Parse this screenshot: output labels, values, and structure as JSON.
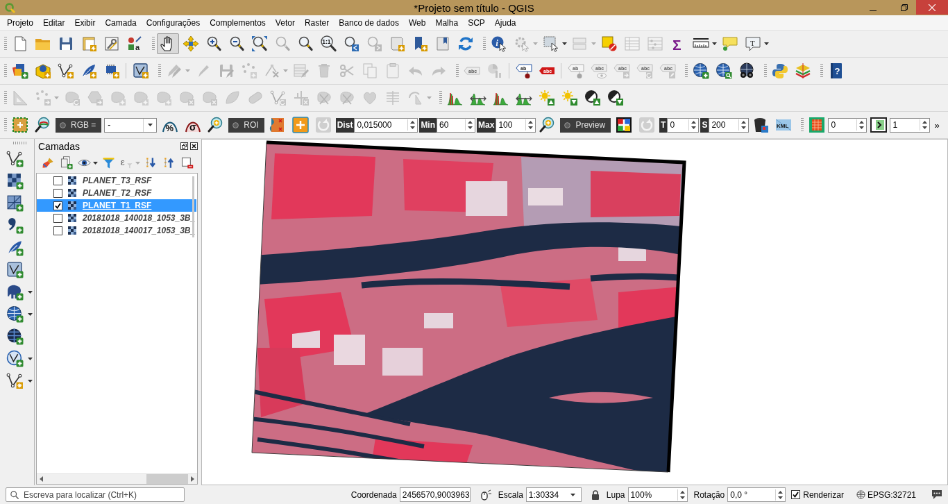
{
  "window": {
    "title": "*Projeto sem título - QGIS"
  },
  "menu": [
    "Projeto",
    "Editar",
    "Exibir",
    "Camada",
    "Configurações",
    "Complementos",
    "Vetor",
    "Raster",
    "Banco de dados",
    "Web",
    "Malha",
    "SCP",
    "Ajuda"
  ],
  "toolbars": [
    {
      "groups": [
        {
          "tools": [
            {
              "kind": "page",
              "disabled": false
            },
            {
              "kind": "folder",
              "disabled": false
            },
            {
              "kind": "floppy",
              "disabled": false
            },
            {
              "kind": "layout",
              "disabled": false
            },
            {
              "kind": "wrench",
              "disabled": false
            },
            {
              "kind": "style",
              "disabled": false,
              "glyph": "a"
            }
          ]
        },
        {
          "tools": [
            {
              "kind": "hand",
              "disabled": false,
              "pressed": true
            },
            {
              "kind": "movearrows",
              "disabled": false,
              "pressed": false
            },
            {
              "kind": "zoomin",
              "disabled": false,
              "pressed": false
            },
            {
              "kind": "zoomout",
              "disabled": false,
              "pressed": false
            },
            {
              "kind": "zoomfull",
              "disabled": false,
              "pressed": false
            },
            {
              "kind": "zoomplain",
              "disabled": true,
              "pressed": false
            },
            {
              "kind": "zoomplain",
              "disabled": false,
              "pressed": false
            },
            {
              "kind": "zoomnative",
              "disabled": false,
              "pressed": false,
              "glyph": "1:1"
            },
            {
              "kind": "zoomlast",
              "disabled": false,
              "pressed": false
            },
            {
              "kind": "zoomnext",
              "disabled": true,
              "pressed": false
            },
            {
              "kind": "mapsheet",
              "disabled": false,
              "pressed": false
            },
            {
              "kind": "bookmarkadd",
              "disabled": false,
              "pressed": false
            },
            {
              "kind": "bookmarks",
              "disabled": false,
              "pressed": false
            },
            {
              "kind": "refresh",
              "disabled": false,
              "pressed": false
            }
          ]
        },
        {
          "tools": [
            {
              "kind": "identify",
              "disabled": false,
              "glyph": "i"
            },
            {
              "kind": "action",
              "disabled": true
            },
            {
              "kind": "caret",
              "disabled": true
            },
            {
              "kind": "select",
              "disabled": false
            },
            {
              "kind": "caret",
              "disabled": false
            },
            {
              "kind": "selform",
              "disabled": true
            },
            {
              "kind": "caret",
              "disabled": true
            },
            {
              "kind": "deselect",
              "disabled": false
            },
            {
              "kind": "table",
              "disabled": true
            },
            {
              "kind": "abacus",
              "disabled": true
            },
            {
              "kind": "sigma",
              "disabled": false,
              "glyph": "Σ"
            },
            {
              "kind": "ruler",
              "disabled": false
            },
            {
              "kind": "caret",
              "disabled": false
            },
            {
              "kind": "balloon",
              "disabled": false
            },
            {
              "kind": "textnote",
              "disabled": false,
              "glyph": "T"
            },
            {
              "kind": "caret",
              "disabled": false
            }
          ]
        }
      ]
    },
    {
      "groups": [
        {
          "tools": [
            {
              "kind": "datasource",
              "disabled": false
            },
            {
              "kind": "geopackage",
              "disabled": false
            },
            {
              "kind": "shapefile",
              "disabled": false
            },
            {
              "kind": "spatialite",
              "disabled": false
            },
            {
              "kind": "scratch",
              "disabled": false
            },
            {
              "kind": "sep"
            },
            {
              "kind": "virtual",
              "disabled": false
            }
          ]
        },
        {
          "tools": [
            {
              "kind": "pencils",
              "disabled": true
            },
            {
              "kind": "caret",
              "disabled": true
            },
            {
              "kind": "pencil",
              "disabled": true
            },
            {
              "kind": "floppyedit",
              "disabled": true
            },
            {
              "kind": "addpoints",
              "disabled": true
            },
            {
              "kind": "vertex",
              "disabled": true
            },
            {
              "kind": "caret",
              "disabled": true
            },
            {
              "kind": "attredit",
              "disabled": true
            },
            {
              "kind": "trash",
              "disabled": true
            },
            {
              "kind": "scissors",
              "disabled": true
            },
            {
              "kind": "copy",
              "disabled": true
            },
            {
              "kind": "paste",
              "disabled": true
            },
            {
              "kind": "undo",
              "disabled": true
            },
            {
              "kind": "redo",
              "disabled": true
            }
          ]
        },
        {
          "tools": [
            {
              "kind": "tag",
              "disabled": true,
              "glyph": "abc"
            },
            {
              "kind": "diagram",
              "disabled": true
            },
            {
              "kind": "sep"
            },
            {
              "kind": "tagpin",
              "disabled": false,
              "glyph": "ab"
            },
            {
              "kind": "tagred",
              "disabled": false,
              "glyph": "abc"
            },
            {
              "kind": "sep"
            },
            {
              "kind": "tagpin",
              "disabled": true,
              "glyph": "ab"
            },
            {
              "kind": "tageye",
              "disabled": true,
              "glyph": "abc"
            },
            {
              "kind": "tagmove",
              "disabled": true,
              "glyph": "abc"
            },
            {
              "kind": "tagrot",
              "disabled": true,
              "glyph": "abc"
            },
            {
              "kind": "tagedit",
              "disabled": true,
              "glyph": "abc"
            }
          ]
        },
        {
          "tools": [
            {
              "kind": "globeadd",
              "disabled": false
            },
            {
              "kind": "globesearch",
              "disabled": false
            },
            {
              "kind": "globebinoc",
              "disabled": false
            }
          ]
        },
        {
          "tools": [
            {
              "kind": "python",
              "disabled": false
            },
            {
              "kind": "scp",
              "disabled": false
            }
          ]
        },
        {
          "tools": [
            {
              "kind": "help",
              "disabled": false,
              "glyph": "?"
            }
          ]
        }
      ]
    },
    {
      "groups": [
        {
          "tools": [
            {
              "kind": "setsquare",
              "disabled": true
            },
            {
              "kind": "pointsmove",
              "disabled": true
            },
            {
              "kind": "caret",
              "disabled": true
            },
            {
              "kind": "blobrot",
              "disabled": true
            },
            {
              "kind": "hexmove",
              "disabled": true
            },
            {
              "kind": "blobstar",
              "disabled": true
            },
            {
              "kind": "blobstar",
              "disabled": true
            },
            {
              "kind": "blobstar",
              "disabled": true
            },
            {
              "kind": "blobx",
              "disabled": true
            },
            {
              "kind": "blobx",
              "disabled": true
            },
            {
              "kind": "leaf",
              "disabled": true
            },
            {
              "kind": "capsule",
              "disabled": true
            },
            {
              "kind": "vrot",
              "disabled": true
            },
            {
              "kind": "splitx",
              "disabled": true
            },
            {
              "kind": "blobcut",
              "disabled": true
            },
            {
              "kind": "blobcut",
              "disabled": true
            },
            {
              "kind": "merge",
              "disabled": true
            },
            {
              "kind": "align",
              "disabled": true
            },
            {
              "kind": "rotpointer",
              "disabled": true
            },
            {
              "kind": "caret",
              "disabled": true
            }
          ]
        },
        {
          "tools": [
            {
              "kind": "histo",
              "disabled": false
            },
            {
              "kind": "histoarrows",
              "disabled": false
            },
            {
              "kind": "histo",
              "disabled": false
            },
            {
              "kind": "histoarrows",
              "disabled": false
            },
            {
              "kind": "sunup",
              "disabled": false
            },
            {
              "kind": "sundown",
              "disabled": false
            },
            {
              "kind": "contrastup",
              "disabled": false
            },
            {
              "kind": "contrastdown",
              "disabled": false
            }
          ]
        }
      ]
    },
    {
      "groups": [
        {
          "tools": [
            {
              "kind": "scproi",
              "disabled": false
            },
            {
              "kind": "magband",
              "disabled": false
            },
            {
              "kind": "chip",
              "label": "RGB =",
              "checked": false
            },
            {
              "kind": "combo",
              "value": "-"
            },
            {
              "kind": "pct",
              "disabled": false,
              "glyph": "%"
            },
            {
              "kind": "sig",
              "disabled": false,
              "glyph": "σ"
            },
            {
              "kind": "zoomplus",
              "disabled": false
            },
            {
              "kind": "chip",
              "label": "ROI",
              "checked": false
            },
            {
              "kind": "roix",
              "disabled": false
            },
            {
              "kind": "orangeplus",
              "disabled": false
            },
            {
              "kind": "refreshgrey",
              "disabled": true
            },
            {
              "kind": "param",
              "label": "Dist"
            },
            {
              "kind": "spin",
              "value": "0,015000"
            },
            {
              "kind": "param",
              "label": "Min"
            },
            {
              "kind": "spin",
              "value": "60"
            },
            {
              "kind": "param",
              "label": "Max"
            },
            {
              "kind": "spin",
              "value": "100"
            },
            {
              "kind": "zoomplus",
              "disabled": false
            },
            {
              "kind": "chip",
              "label": "Preview",
              "checked": false
            },
            {
              "kind": "colorful",
              "disabled": false
            },
            {
              "kind": "refreshgrey",
              "disabled": true
            },
            {
              "kind": "param",
              "label": "T"
            },
            {
              "kind": "spin",
              "value": "0"
            },
            {
              "kind": "param",
              "label": "S"
            },
            {
              "kind": "spin",
              "value": "200"
            },
            {
              "kind": "bin",
              "disabled": false
            },
            {
              "kind": "kml",
              "disabled": false,
              "glyph": "KML"
            }
          ]
        },
        {
          "tools": [
            {
              "kind": "gridicon",
              "disabled": false
            },
            {
              "kind": "spin",
              "value": "0"
            },
            {
              "kind": "arrowbox",
              "disabled": false
            },
            {
              "kind": "spin",
              "value": "1"
            },
            {
              "kind": "more",
              "label": "»"
            }
          ]
        }
      ]
    }
  ],
  "side_toolbar": {
    "tools": [
      {
        "kind": "vadd",
        "disabled": false
      },
      {
        "kind": "rasteradd",
        "disabled": false
      },
      {
        "kind": "meshadd",
        "disabled": false
      },
      {
        "kind": "commaadd",
        "disabled": false
      },
      {
        "kind": "featheradd",
        "disabled": false
      },
      {
        "kind": "virtualadd",
        "disabled": false
      },
      {
        "kind": "pgadd",
        "disabled": false
      },
      {
        "kind": "caret",
        "disabled": false
      },
      {
        "kind": "wmsadd",
        "disabled": false
      },
      {
        "kind": "caret",
        "disabled": false
      },
      {
        "kind": "wcsadd",
        "disabled": false
      },
      {
        "kind": "wfsadd",
        "disabled": false
      },
      {
        "kind": "caret",
        "disabled": false
      },
      {
        "kind": "vstar",
        "disabled": false
      },
      {
        "kind": "caret",
        "disabled": false
      }
    ]
  },
  "layers_panel": {
    "title": "Camadas",
    "tools": [
      {
        "kind": "brush",
        "disabled": false
      },
      {
        "kind": "addgroup",
        "disabled": false
      },
      {
        "kind": "eye",
        "disabled": false
      },
      {
        "kind": "caret",
        "disabled": false
      },
      {
        "kind": "funnel",
        "disabled": false
      },
      {
        "kind": "epsilon",
        "disabled": true,
        "glyph": "ε"
      },
      {
        "kind": "caret",
        "disabled": true
      },
      {
        "kind": "expandall",
        "disabled": false
      },
      {
        "kind": "collapseall",
        "disabled": false
      },
      {
        "kind": "removelayer",
        "disabled": false
      }
    ],
    "layers": [
      {
        "name": "PLANET_T3_RSF",
        "checked": false,
        "selected": false
      },
      {
        "name": "PLANET_T2_RSF",
        "checked": false,
        "selected": false
      },
      {
        "name": "PLANET_T1_RSF",
        "checked": true,
        "selected": true
      },
      {
        "name": "20181018_140018_1053_3B_",
        "checked": false,
        "selected": false
      },
      {
        "name": "20181018_140017_1053_3B_",
        "checked": false,
        "selected": false
      }
    ]
  },
  "status_bar": {
    "search": {
      "placeholder": "Escreva para localizar (Ctrl+K)"
    },
    "coordinate": {
      "label": "Coordenada",
      "value": "2456570,9003963"
    },
    "scale": {
      "label": "Escala",
      "value": "1:30334"
    },
    "magnifier": {
      "label": "Lupa",
      "value": "100%"
    },
    "rotation": {
      "label": "Rotação",
      "value": "0,0 °"
    },
    "render": {
      "label": "Renderizar",
      "checked": true
    },
    "crs": {
      "label": "EPSG:32721"
    }
  }
}
